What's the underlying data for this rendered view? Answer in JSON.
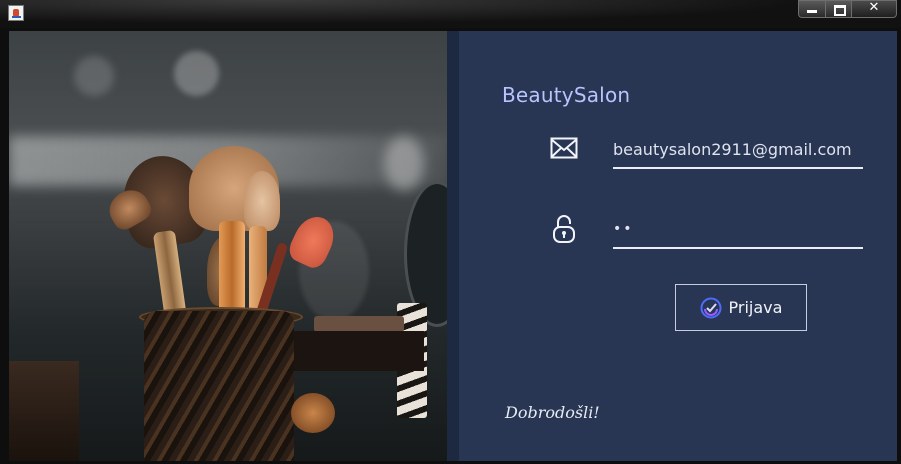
{
  "window": {
    "app_icon": "java-app-icon",
    "buttons": {
      "minimize": "minimize-icon",
      "maximize": "maximize-icon",
      "close": "✕"
    }
  },
  "image": {
    "subject": "makeup-brushes-photo"
  },
  "brand": {
    "title": "BeautySalon"
  },
  "form": {
    "email_icon": "mail-icon",
    "email_value": "beautysalon2911@gmail.com",
    "password_icon": "lock-icon",
    "password_value": "••",
    "login_label": "Prijava",
    "login_icon": "check-circle-icon"
  },
  "footer": {
    "welcome": "Dobrodošli!"
  },
  "colors": {
    "panel_bg": "#283654",
    "brand_text": "#b9c4ff",
    "underline": "#e9ecf3"
  }
}
